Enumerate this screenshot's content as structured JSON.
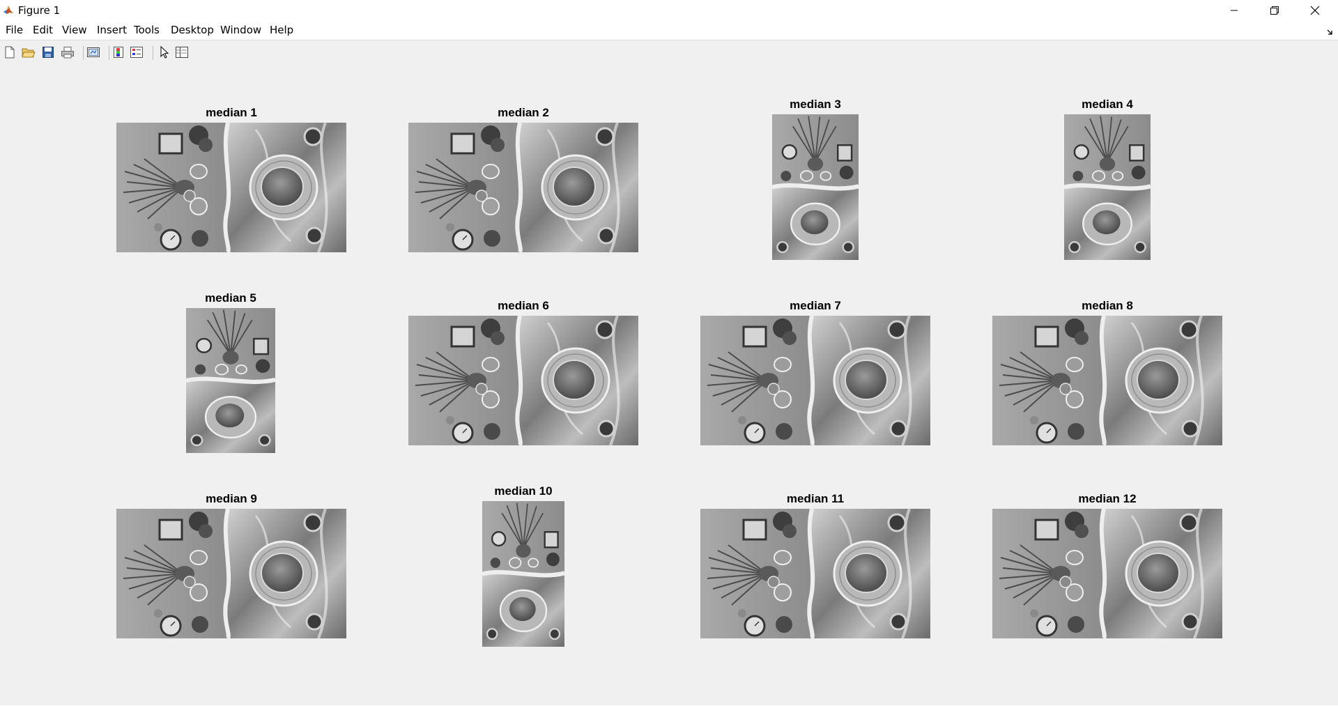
{
  "window": {
    "title": "Figure 1",
    "icon": "matlab-icon",
    "controls": [
      "minimize-icon",
      "restore-icon",
      "close-icon"
    ]
  },
  "menu": [
    "File",
    "Edit",
    "View",
    "Insert",
    "Tools",
    "Desktop",
    "Window",
    "Help"
  ],
  "toolbar": {
    "buttons": [
      "new-figure-icon",
      "open-file-icon",
      "save-figure-icon",
      "print-figure-icon",
      "link-plot-icon",
      "insert-colorbar-icon",
      "insert-legend-icon",
      "edit-plot-icon",
      "open-property-inspector-icon"
    ]
  },
  "figure": {
    "subplots": [
      {
        "title": "median 1",
        "orientation": "landscape",
        "rotation": "ccw"
      },
      {
        "title": "median 2",
        "orientation": "landscape",
        "rotation": "ccw"
      },
      {
        "title": "median 3",
        "orientation": "portrait",
        "rotation": "none"
      },
      {
        "title": "median 4",
        "orientation": "portrait",
        "rotation": "none"
      },
      {
        "title": "median 5",
        "orientation": "portrait",
        "rotation": "none"
      },
      {
        "title": "median 6",
        "orientation": "landscape",
        "rotation": "cw"
      },
      {
        "title": "median 7",
        "orientation": "landscape",
        "rotation": "cw"
      },
      {
        "title": "median 8",
        "orientation": "landscape",
        "rotation": "cw"
      },
      {
        "title": "median 9",
        "orientation": "landscape",
        "rotation": "cw"
      },
      {
        "title": "median 10",
        "orientation": "portrait",
        "rotation": "none"
      },
      {
        "title": "median 11",
        "orientation": "landscape",
        "rotation": "cw"
      },
      {
        "title": "median 12",
        "orientation": "landscape",
        "rotation": "cw"
      }
    ]
  }
}
